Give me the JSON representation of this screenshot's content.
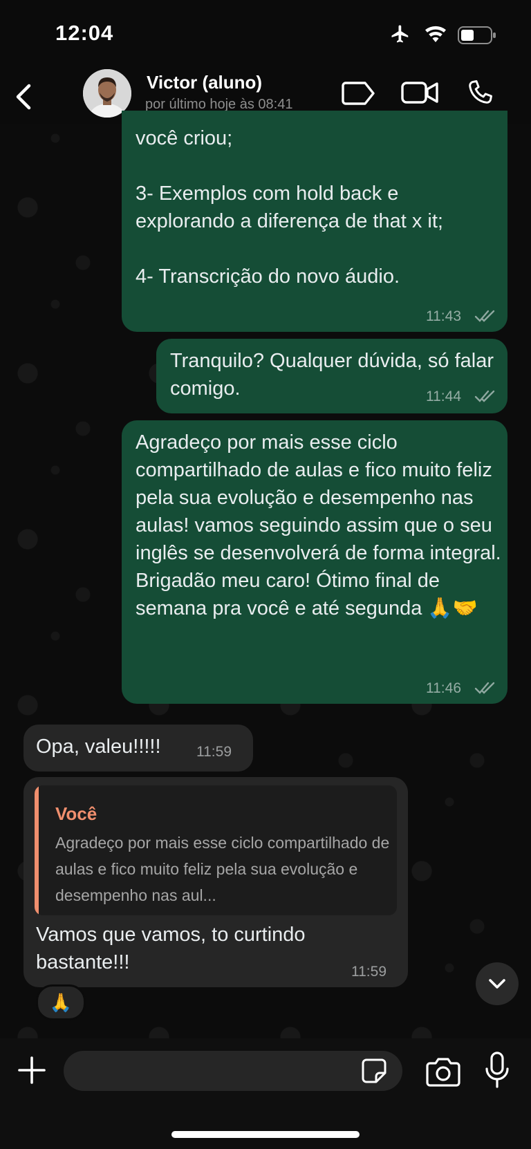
{
  "status_bar": {
    "time": "12:04",
    "icons": [
      "airplane-icon",
      "wifi-icon",
      "battery-icon"
    ]
  },
  "header": {
    "contact_name": "Victor (aluno)",
    "last_seen": "por último hoje às 08:41",
    "icons": [
      "back-chevron-icon",
      "label-tag-icon",
      "video-call-icon",
      "voice-call-icon"
    ]
  },
  "messages": [
    {
      "direction": "out",
      "text": "você criou;\n\n3- Exemplos com hold back e explorando a diferença de that x it;\n\n4- Transcrição do novo áudio.",
      "time": "11:43",
      "status": "read"
    },
    {
      "direction": "out",
      "text": "Tranquilo? Qualquer dúvida, só falar comigo.",
      "time": "11:44",
      "status": "read"
    },
    {
      "direction": "out",
      "text": "Agradeço por mais esse ciclo compartilhado de aulas e fico muito feliz pela sua evolução e desempenho nas aulas! vamos seguindo assim que o seu inglês se desenvolverá de forma integral. Brigadão meu caro! Ótimo final de semana pra você e até segunda 🙏🤝",
      "time": "11:46",
      "status": "read"
    },
    {
      "direction": "in",
      "text": "Opa, valeu!!!!!",
      "time": "11:59"
    },
    {
      "direction": "in",
      "quote": {
        "author": "Você",
        "text": "Agradeço por mais esse ciclo compartilhado de aulas e fico muito feliz pela sua evolução e desempenho nas aul..."
      },
      "text": "Vamos que vamos, to curtindo bastante!!!",
      "time": "11:59",
      "reaction": "🙏"
    }
  ],
  "composer": {
    "placeholder": "",
    "icons": [
      "plus-icon",
      "sticker-icon",
      "camera-icon",
      "microphone-icon"
    ]
  },
  "colors": {
    "outgoing_bubble": "#154d36",
    "incoming_bubble": "#262626",
    "quote_accent": "#f08f6e",
    "read_checks": "#8fa8a0"
  }
}
